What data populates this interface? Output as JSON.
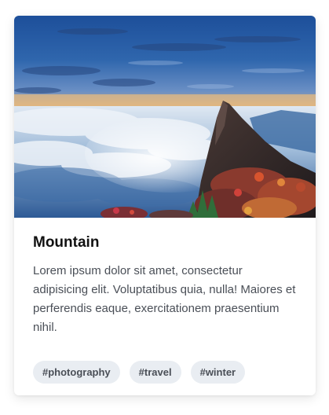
{
  "card": {
    "image_alt": "Mountain peak above a sea of clouds at sunrise",
    "title": "Mountain",
    "text": "Lorem ipsum dolor sit amet, consectetur adipisicing elit. Voluptatibus quia, nulla! Maiores et perferendis eaque, exercitationem praesentium nihil.",
    "tags": [
      "#photography",
      "#travel",
      "#winter"
    ]
  },
  "colors": {
    "title": "#111111",
    "text": "#4a4f57",
    "tag_bg": "#e9edf2",
    "card_bg": "#ffffff"
  }
}
